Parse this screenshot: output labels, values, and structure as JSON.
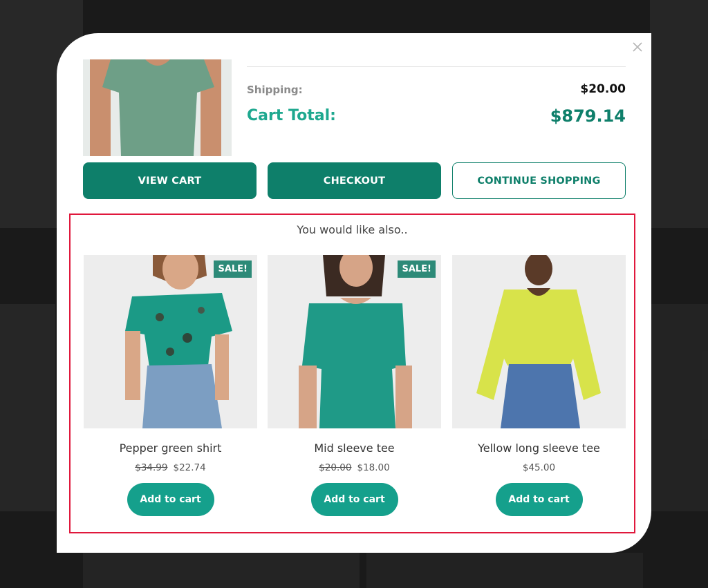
{
  "summary": {
    "shipping_label": "Shipping:",
    "shipping_value": "$20.00",
    "total_label": "Cart Total:",
    "total_value": "$879.14"
  },
  "actions": {
    "view_cart": "VIEW CART",
    "checkout": "CHECKOUT",
    "continue_shopping": "CONTINUE SHOPPING"
  },
  "recommendations": {
    "title": "You would like also..",
    "items": [
      {
        "name": "Pepper green shirt",
        "old_price": "$34.99",
        "price": "$22.74",
        "badge": "SALE!",
        "button": "Add to cart"
      },
      {
        "name": "Mid sleeve tee",
        "old_price": "$20.00",
        "price": "$18.00",
        "badge": "SALE!",
        "button": "Add to cart"
      },
      {
        "name": "Yellow long sleeve tee",
        "price": "$45.00",
        "button": "Add to cart"
      }
    ]
  },
  "colors": {
    "accent": "#0e7f6a",
    "total_label": "#1ea88f",
    "add_button": "#15a08c",
    "sale_badge": "#2d8a78",
    "highlight_border": "#e0183c"
  }
}
